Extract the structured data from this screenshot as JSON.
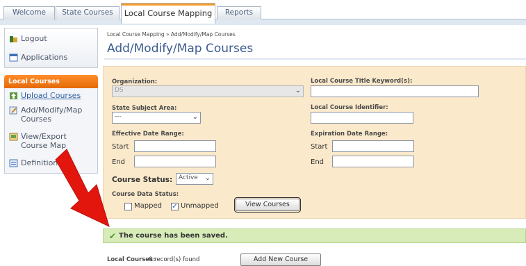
{
  "tabs": [
    {
      "label": "Welcome",
      "active": false
    },
    {
      "label": "State Courses",
      "active": false
    },
    {
      "label": "Local Course Mapping",
      "active": true
    },
    {
      "label": "Reports",
      "active": false
    }
  ],
  "sidebar": {
    "top_items": [
      {
        "label": "Logout",
        "icon": "logout-icon"
      },
      {
        "label": "Applications",
        "icon": "applications-icon"
      }
    ],
    "section_title": "Local Courses",
    "section_items": [
      {
        "label": "Upload Courses",
        "icon": "upload-icon",
        "link": true
      },
      {
        "label": "Add/Modify/Map Courses",
        "icon": "edit-doc-icon",
        "link": false
      },
      {
        "label": "View/Export Course Map",
        "icon": "view-export-icon",
        "link": false
      },
      {
        "label": "Definitions",
        "icon": "definitions-icon",
        "link": false
      }
    ]
  },
  "breadcrumb": "Local Course Mapping » Add/Modify/Map Courses",
  "page_title": "Add/Modify/Map Courses",
  "form": {
    "organization_label": "Organization:",
    "organization_value": "DS",
    "keyword_label": "Local Course Title Keyword(s):",
    "keyword_value": "",
    "subject_label": "State Subject Area:",
    "subject_value": "---",
    "identifier_label": "Local Course Identifier:",
    "identifier_value": "",
    "effective_label": "Effective Date Range:",
    "expiration_label": "Expiration Date Range:",
    "start_label": "Start",
    "end_label": "End",
    "course_status_label": "Course Status:",
    "course_status_value": "Active",
    "data_status_label": "Course Data Status:",
    "mapped_label": "Mapped",
    "mapped_checked": false,
    "unmapped_label": "Unmapped",
    "unmapped_checked": true,
    "view_button": "View Courses"
  },
  "success_message": "The course has been saved.",
  "results": {
    "label": "Local Courses:",
    "count_text": "0 record(s) found",
    "add_button": "Add New Course"
  },
  "colors": {
    "accent_orange": "#e56a08",
    "panel_bg": "#fbe9cb",
    "success_bg": "#d8ecb9",
    "annotation_arrow": "#e3160d"
  }
}
